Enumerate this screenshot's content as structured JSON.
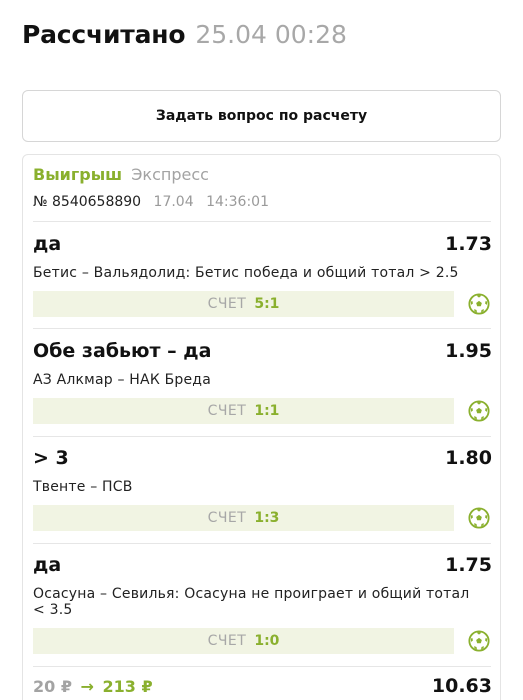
{
  "header": {
    "title": "Рассчитано",
    "datetime": "25.04 00:28"
  },
  "ask_button_label": "Задать вопрос по расчету",
  "bet": {
    "status": "Выигрыш",
    "type": "Экспресс",
    "number": "№ 8540658890",
    "date": "17.04",
    "time": "14:36:01",
    "score_label": "СЧЕТ",
    "events": [
      {
        "outcome": "да",
        "coef": "1.73",
        "description": "Бетис – Вальядолид: Бетис победа и общий тотал > 2.5",
        "score": "5:1"
      },
      {
        "outcome": "Обе забьют – да",
        "coef": "1.95",
        "description": "АЗ Алкмар – НАК Бреда",
        "score": "1:1"
      },
      {
        "outcome": "> 3",
        "coef": "1.80",
        "description": "Твенте – ПСВ",
        "score": "1:3"
      },
      {
        "outcome": "да",
        "coef": "1.75",
        "description": "Осасуна – Севилья: Осасуна не проиграет и общий тотал < 3.5",
        "score": "1:0"
      }
    ],
    "stake": "20 ₽",
    "arrow": "→",
    "payout": "213 ₽",
    "total_coef": "10.63"
  },
  "colors": {
    "accent": "#8ab02e",
    "score_bg": "#f1f4e3",
    "muted": "#a3a3a3"
  },
  "icons": {
    "sport": "soccer-ball-icon"
  }
}
